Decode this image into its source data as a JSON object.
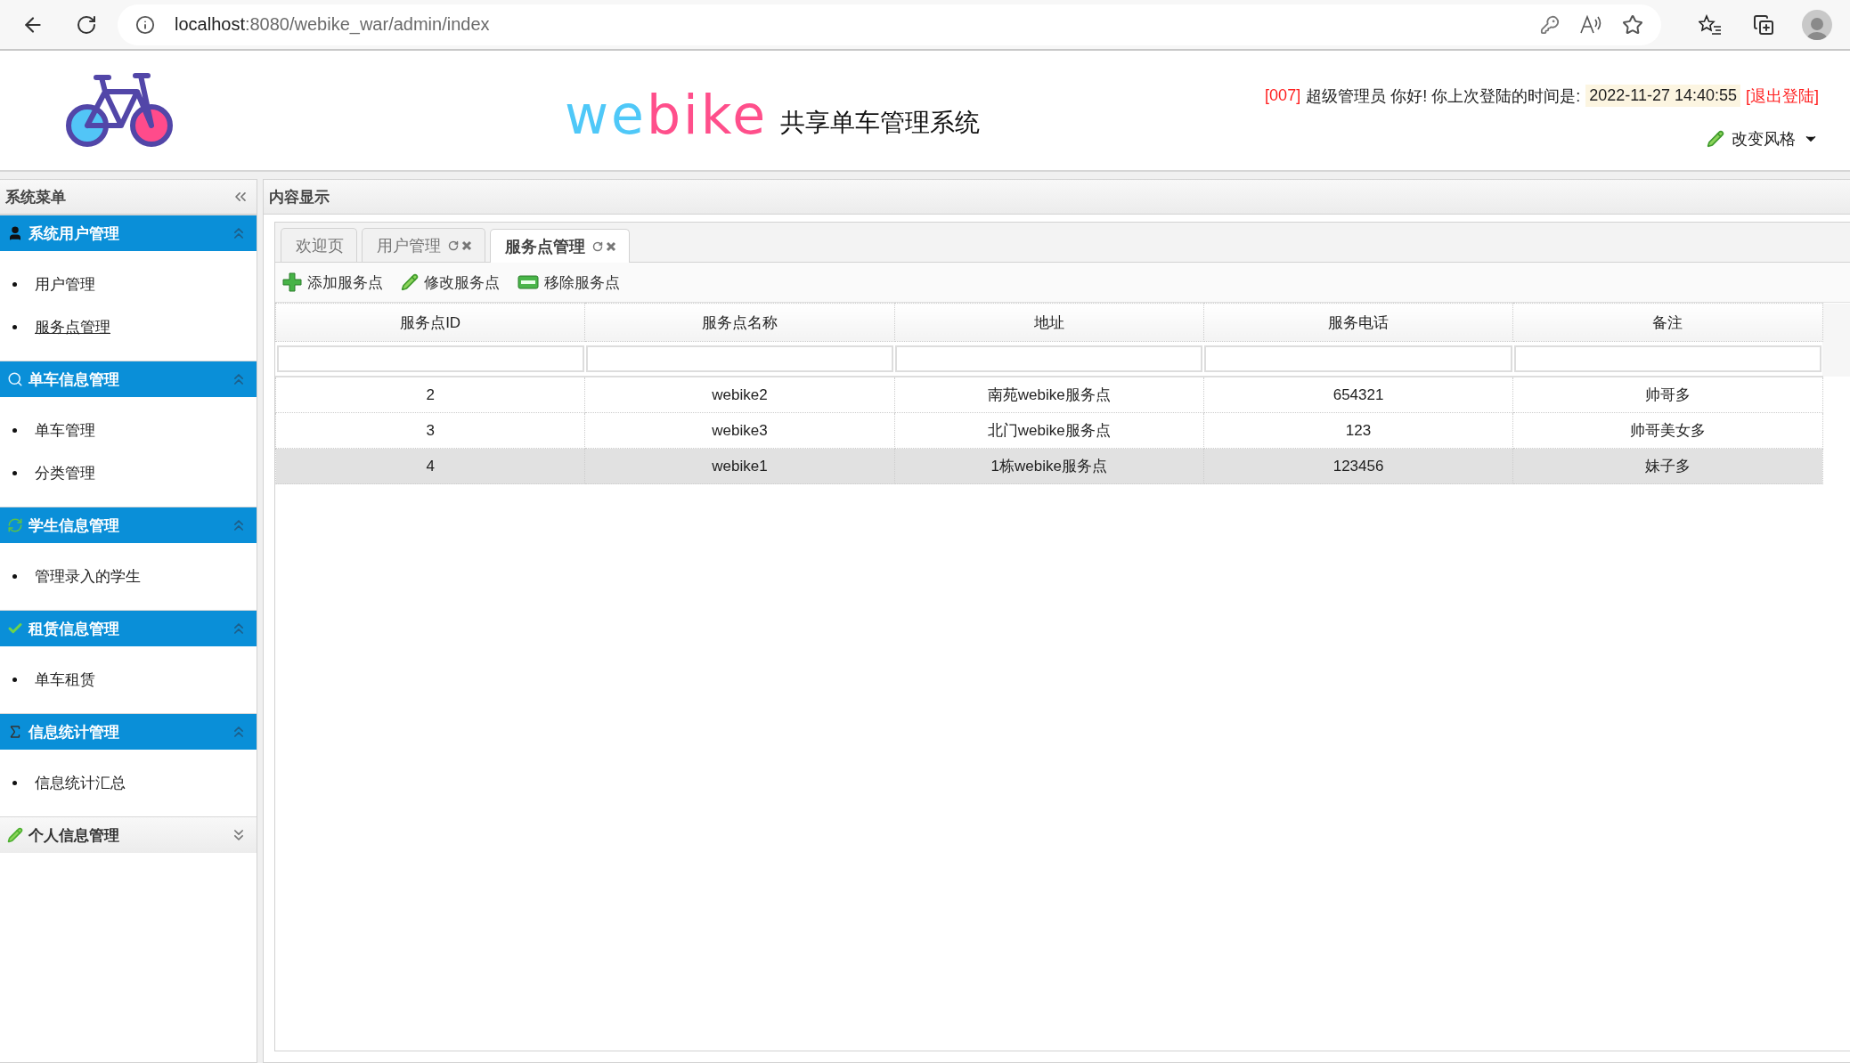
{
  "browser": {
    "url_host": "localhost",
    "url_path": ":8080/webike_war/admin/index"
  },
  "header": {
    "logo_parts": [
      {
        "text": "we",
        "color": "#4fc8f8"
      },
      {
        "text": "bike",
        "color": "#ff4f8b"
      }
    ],
    "subtitle": "共享单车管理系统",
    "user_id": "[007]",
    "greeting": "超级管理员 你好! 你上次登陆的时间是:",
    "last_login": "2022-11-27 14:40:55",
    "logout": "[退出登陆]",
    "theme_menu": "改变风格"
  },
  "sidebar": {
    "title": "系统菜单",
    "groups": [
      {
        "title": "系统用户管理",
        "kind": "user",
        "expanded": true,
        "items": [
          {
            "label": "用户管理",
            "selected": false
          },
          {
            "label": "服务点管理",
            "selected": true
          }
        ]
      },
      {
        "title": "单车信息管理",
        "kind": "search",
        "expanded": true,
        "items": [
          {
            "label": "单车管理",
            "selected": false
          },
          {
            "label": "分类管理",
            "selected": false
          }
        ]
      },
      {
        "title": "学生信息管理",
        "kind": "refresh",
        "expanded": true,
        "items": [
          {
            "label": "管理录入的学生",
            "selected": false
          }
        ]
      },
      {
        "title": "租赁信息管理",
        "kind": "check",
        "expanded": true,
        "items": [
          {
            "label": "单车租赁",
            "selected": false
          }
        ]
      },
      {
        "title": "信息统计管理",
        "kind": "sigma",
        "expanded": true,
        "items": [
          {
            "label": "信息统计汇总",
            "selected": false
          }
        ]
      },
      {
        "title": "个人信息管理",
        "kind": "pencil",
        "expanded": false
      }
    ]
  },
  "content": {
    "title": "内容显示",
    "tabs": [
      {
        "label": "欢迎页",
        "selected": false,
        "closable": false
      },
      {
        "label": "用户管理",
        "selected": false,
        "closable": true
      },
      {
        "label": "服务点管理",
        "selected": true,
        "closable": true
      }
    ],
    "toolbar": [
      {
        "label": "添加服务点",
        "kind": "add"
      },
      {
        "label": "修改服务点",
        "kind": "edit"
      },
      {
        "label": "移除服务点",
        "kind": "remove"
      }
    ],
    "table": {
      "columns": [
        "服务点ID",
        "服务点名称",
        "地址",
        "服务电话",
        "备注"
      ],
      "rows": [
        {
          "cells": [
            "2",
            "webike2",
            "南苑webike服务点",
            "654321",
            "帅哥多"
          ],
          "selected": false
        },
        {
          "cells": [
            "3",
            "webike3",
            "北门webike服务点",
            "123",
            "帅哥美女多"
          ],
          "selected": false
        },
        {
          "cells": [
            "4",
            "webike1",
            "1栋webike服务点",
            "123456",
            "妹子多"
          ],
          "selected": true
        }
      ]
    }
  }
}
